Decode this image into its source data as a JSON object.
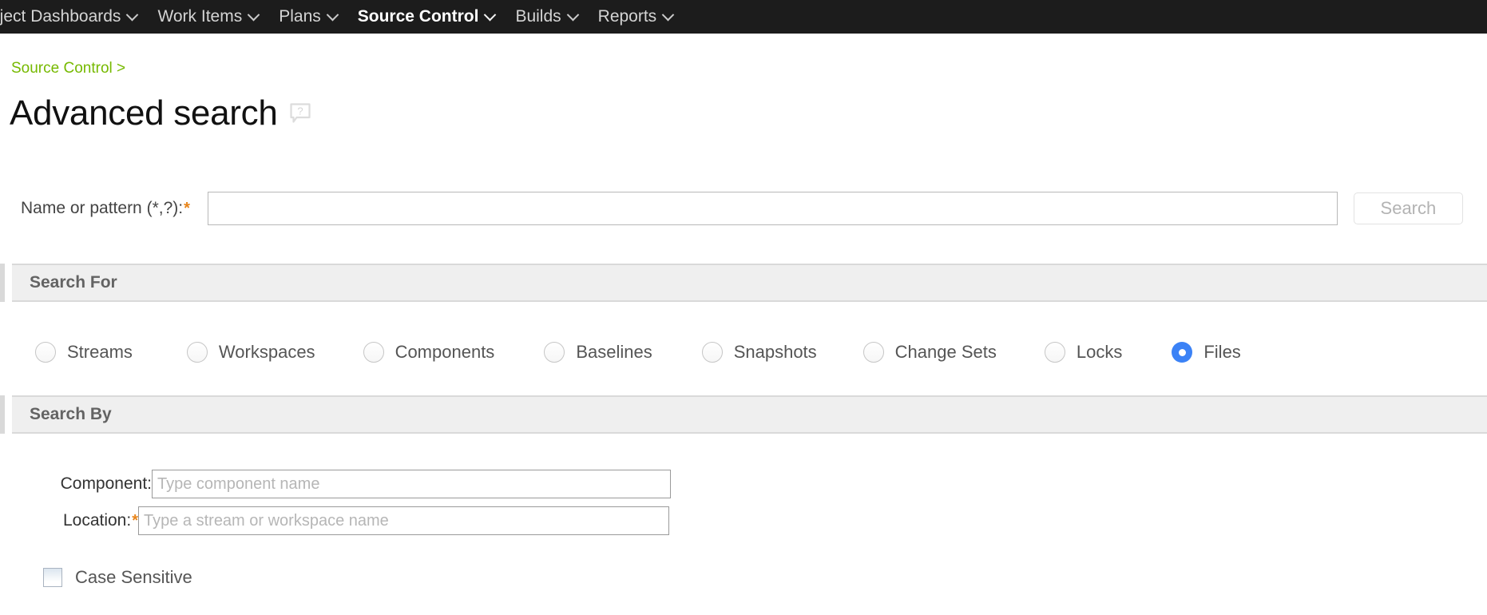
{
  "nav": {
    "items": [
      {
        "label": "oject Dashboards",
        "active": false,
        "caret": "chevron-down-icon"
      },
      {
        "label": "Work Items",
        "active": false,
        "caret": "chevron-down-icon"
      },
      {
        "label": "Plans",
        "active": false,
        "caret": "chevron-down-icon"
      },
      {
        "label": "Source Control",
        "active": true,
        "caret": "chevron-down-icon"
      },
      {
        "label": "Builds",
        "active": false,
        "caret": "chevron-down-icon"
      },
      {
        "label": "Reports",
        "active": false,
        "caret": "chevron-down-icon"
      }
    ]
  },
  "breadcrumb": {
    "text": "Source Control >"
  },
  "page": {
    "title": "Advanced search",
    "help_icon": "help-question-bubble-icon"
  },
  "pattern": {
    "label": "Name or pattern (*,?):",
    "required_marker": "*",
    "value": "",
    "placeholder": "",
    "search_button": "Search",
    "search_button_enabled": false
  },
  "search_for": {
    "title": "Search For",
    "options": [
      {
        "label": "Streams",
        "selected": false
      },
      {
        "label": "Workspaces",
        "selected": false
      },
      {
        "label": "Components",
        "selected": false
      },
      {
        "label": "Baselines",
        "selected": false
      },
      {
        "label": "Snapshots",
        "selected": false
      },
      {
        "label": "Change Sets",
        "selected": false
      },
      {
        "label": "Locks",
        "selected": false
      },
      {
        "label": "Files",
        "selected": true
      }
    ]
  },
  "search_by": {
    "title": "Search By",
    "component": {
      "label": "Component:",
      "value": "",
      "placeholder": "Type component name"
    },
    "location": {
      "label": "Location:",
      "required_marker": "*",
      "value": "",
      "placeholder": "Type a stream or workspace name"
    },
    "case_sensitive": {
      "label": "Case Sensitive",
      "checked": false
    }
  },
  "colors": {
    "navbar_bg": "#1c1c1c",
    "breadcrumb_link": "#76b900",
    "required_asterisk": "#e8851a",
    "selected_radio": "#3b82f6",
    "section_header_bg": "#efefef"
  }
}
